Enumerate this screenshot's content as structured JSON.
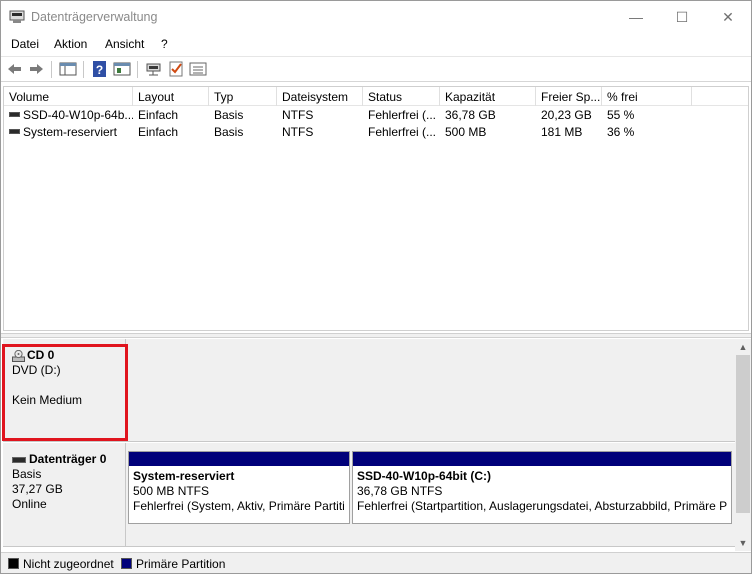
{
  "window": {
    "title": "Datenträgerverwaltung",
    "controls": {
      "minimize": "—",
      "maximize": "☐",
      "close": "✕"
    }
  },
  "menu": [
    "Datei",
    "Aktion",
    "Ansicht",
    "?"
  ],
  "toolbar": {
    "icons": [
      "back-arrow-icon",
      "forward-arrow-icon",
      "console-tree-icon",
      "help-icon",
      "properties-icon",
      "connect-icon",
      "checklist-icon",
      "list-view-icon"
    ]
  },
  "volume_list": {
    "columns": [
      "Volume",
      "Layout",
      "Typ",
      "Dateisystem",
      "Status",
      "Kapazität",
      "Freier Sp...",
      "% frei"
    ],
    "rows": [
      [
        "SSD-40-W10p-64b...",
        "Einfach",
        "Basis",
        "NTFS",
        "Fehlerfrei (...",
        "36,78 GB",
        "20,23 GB",
        "55 %"
      ],
      [
        "System-reserviert",
        "Einfach",
        "Basis",
        "NTFS",
        "Fehlerfrei (...",
        "500 MB",
        "181 MB",
        "36 %"
      ]
    ]
  },
  "disks": {
    "cd0": {
      "name": "CD 0",
      "line1": "DVD (D:)",
      "line2": "Kein Medium"
    },
    "disk0": {
      "name": "Datenträger 0",
      "type": "Basis",
      "size": "37,27 GB",
      "status": "Online",
      "partitions": [
        {
          "name": "System-reserviert",
          "size": "500 MB NTFS",
          "status": "Fehlerfrei (System, Aktiv, Primäre Partiti"
        },
        {
          "name": "SSD-40-W10p-64bit  (C:)",
          "size": "36,78 GB NTFS",
          "status": "Fehlerfrei (Startpartition, Auslagerungsdatei, Absturzabbild, Primäre P"
        }
      ]
    }
  },
  "legend": [
    {
      "label": "Nicht zugeordnet",
      "color": "#000000"
    },
    {
      "label": "Primäre Partition",
      "color": "#00007a"
    }
  ],
  "colors": {
    "primary_partition": "#00007a",
    "highlight": "#e0141e"
  }
}
